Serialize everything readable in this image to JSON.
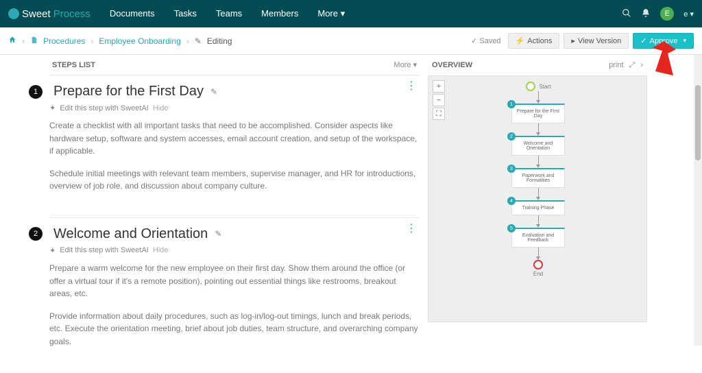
{
  "brand": {
    "main": "Sweet",
    "secondary": "Process"
  },
  "nav": {
    "documents": "Documents",
    "tasks": "Tasks",
    "teams": "Teams",
    "members": "Members",
    "more": "More"
  },
  "user": {
    "initial": "E",
    "label": "e"
  },
  "crumbs": {
    "procedures": "Procedures",
    "doc": "Employee Onboarding",
    "editing": "Editing"
  },
  "subbar": {
    "saved": "Saved",
    "actions": "Actions",
    "view_version": "View Version",
    "approve": "Approve"
  },
  "stepsHeader": {
    "label": "STEPS LIST",
    "more": "More"
  },
  "steps": [
    {
      "num": "1",
      "title": "Prepare for the First Day",
      "editAI": "Edit this step with SweetAI",
      "hide": "Hide",
      "p1": "Create a checklist with all important tasks that need to be accomplished. Consider aspects like hardware setup, software and system accesses, email account creation, and setup of the workspace, if applicable.",
      "p2": "Schedule initial meetings with relevant team members, supervise manager, and HR for introductions, overview of job role, and discussion about company culture."
    },
    {
      "num": "2",
      "title": "Welcome and Orientation",
      "editAI": "Edit this step with SweetAI",
      "hide": "Hide",
      "p1": "Prepare a warm welcome for the new employee on their first day. Show them around the office (or offer a virtual tour if it's a remote position), pointing out essential things like restrooms, breakout areas, etc.",
      "p2": "Provide information about daily procedures, such as log-in/log-out timings, lunch and break periods, etc. Execute the orientation meeting, brief about job duties, team structure, and overarching company goals."
    }
  ],
  "overview": {
    "label": "OVERVIEW",
    "print": "print",
    "start": "Start",
    "end": "End",
    "nodes": [
      {
        "num": "1",
        "label": "Prepare for the First Day"
      },
      {
        "num": "2",
        "label": "Welcome and Orientation"
      },
      {
        "num": "3",
        "label": "Paperwork and Formalities"
      },
      {
        "num": "4",
        "label": "Training Phase"
      },
      {
        "num": "5",
        "label": "Evaluation and Feedback"
      }
    ]
  }
}
